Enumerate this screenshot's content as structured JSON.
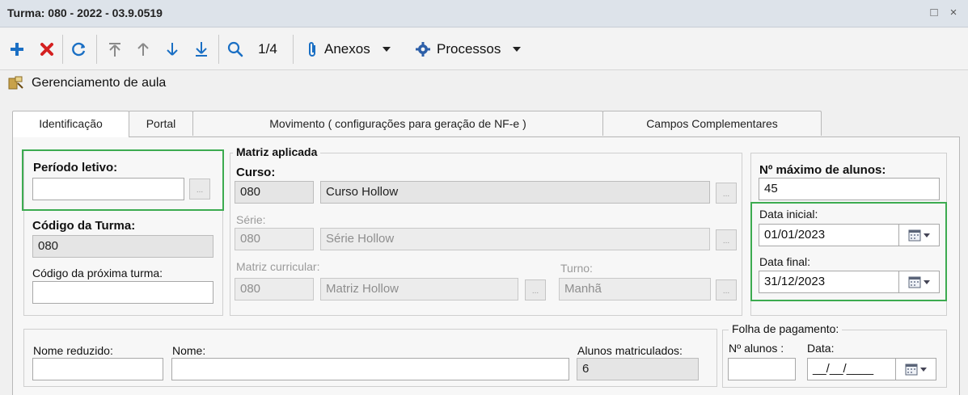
{
  "window": {
    "title": "Turma: 080 - 2022 - 03.9.0519",
    "maximize_glyph": "□",
    "close_glyph": "×"
  },
  "toolbar": {
    "icons": [
      "plus-icon",
      "delete-x-icon",
      "refresh-icon",
      "first-record-icon",
      "previous-record-icon",
      "next-record-icon",
      "last-record-icon",
      "search-icon",
      "paperclip-icon",
      "gear-icon"
    ],
    "record_counter": "1/4",
    "attachments_label": "Anexos",
    "processes_label": "Processos"
  },
  "breadcrumb": {
    "label": "Gerenciamento de aula"
  },
  "tabs": [
    {
      "label": "Identificação",
      "active": true
    },
    {
      "label": "Portal"
    },
    {
      "label": "Movimento ( configurações para geração de NF-e )"
    },
    {
      "label": "Campos Complementares"
    }
  ],
  "form": {
    "periodo": {
      "label": "Período letivo:",
      "value": ""
    },
    "codigo_turma": {
      "label": "Código da Turma:",
      "value": "080"
    },
    "proxima_turma": {
      "label": "Código da próxima turma:",
      "value": ""
    },
    "matriz": {
      "legend": "Matriz aplicada",
      "curso_label": "Curso:",
      "curso_code": "080",
      "curso_name": "Curso Hollow",
      "serie_label": "Série:",
      "serie_code": "080",
      "serie_name": "Série Hollow",
      "matriz_label": "Matriz curricular:",
      "matriz_code": "080",
      "matriz_name": "Matriz Hollow",
      "turno_label": "Turno:",
      "turno_value": "Manhã"
    },
    "max_alunos": {
      "label": "Nº máximo de alunos:",
      "value": "45"
    },
    "data_inicial": {
      "label": "Data inicial:",
      "value": "01/01/2023"
    },
    "data_final": {
      "label": "Data final:",
      "value": "31/12/2023"
    },
    "nome_reduzido": {
      "label": "Nome reduzido:",
      "value": ""
    },
    "nome": {
      "label": "Nome:",
      "value": ""
    },
    "alunos_matriculados": {
      "label": "Alunos matriculados:",
      "value": "6"
    },
    "folha": {
      "legend": "Folha de pagamento:",
      "n_alunos_label": "Nº alunos :",
      "n_alunos_value": "",
      "data_label": "Data:",
      "data_value": "__/__/____"
    },
    "ellipsis": "..."
  },
  "colors": {
    "highlight": "#3cab50",
    "plus": "#1a6fc4",
    "delete": "#d42020",
    "arrow": "#1a6fc4"
  }
}
